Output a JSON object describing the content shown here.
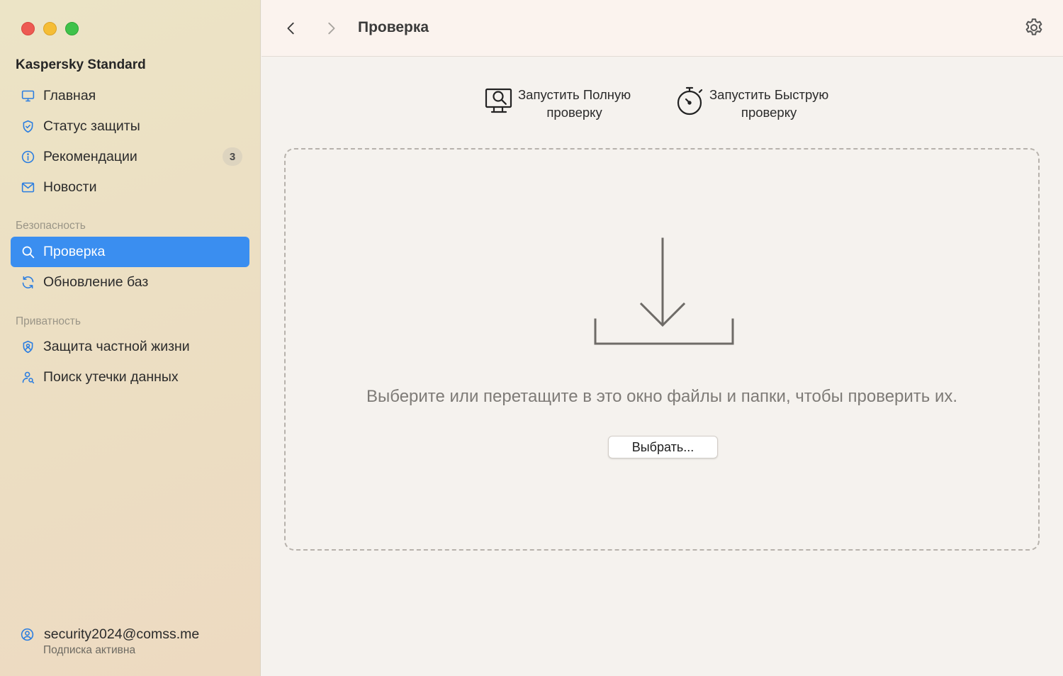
{
  "window": {
    "controls": [
      "close",
      "minimize",
      "zoom"
    ]
  },
  "sidebar": {
    "app_title": "Kaspersky Standard",
    "main_items": [
      {
        "label": "Главная",
        "icon": "monitor-icon"
      },
      {
        "label": "Статус защиты",
        "icon": "shield-icon"
      },
      {
        "label": "Рекомендации",
        "icon": "info-icon",
        "badge": "3"
      },
      {
        "label": "Новости",
        "icon": "mail-icon"
      }
    ],
    "security_section": {
      "label": "Безопасность",
      "items": [
        {
          "label": "Проверка",
          "icon": "search-icon",
          "active": true
        },
        {
          "label": "Обновление баз",
          "icon": "refresh-icon"
        }
      ]
    },
    "privacy_section": {
      "label": "Приватность",
      "items": [
        {
          "label": "Защита частной жизни",
          "icon": "shield-user-icon"
        },
        {
          "label": "Поиск утечки данных",
          "icon": "user-search-icon"
        }
      ]
    },
    "account": {
      "email": "security2024@comss.me",
      "status": "Подписка активна"
    }
  },
  "header": {
    "title": "Проверка"
  },
  "actions": {
    "full_scan": {
      "line1": "Запустить Полную",
      "line2": "проверку"
    },
    "quick_scan": {
      "line1": "Запустить Быструю",
      "line2": "проверку"
    }
  },
  "dropzone": {
    "text": "Выберите или перетащите в это окно файлы и папки, чтобы проверить их.",
    "button_label": "Выбрать..."
  },
  "colors": {
    "accent": "#3a8ef0",
    "icon_blue": "#2a7de1",
    "sidebar_bg": "#ece4c6",
    "content_bg": "#f5f2ee"
  }
}
